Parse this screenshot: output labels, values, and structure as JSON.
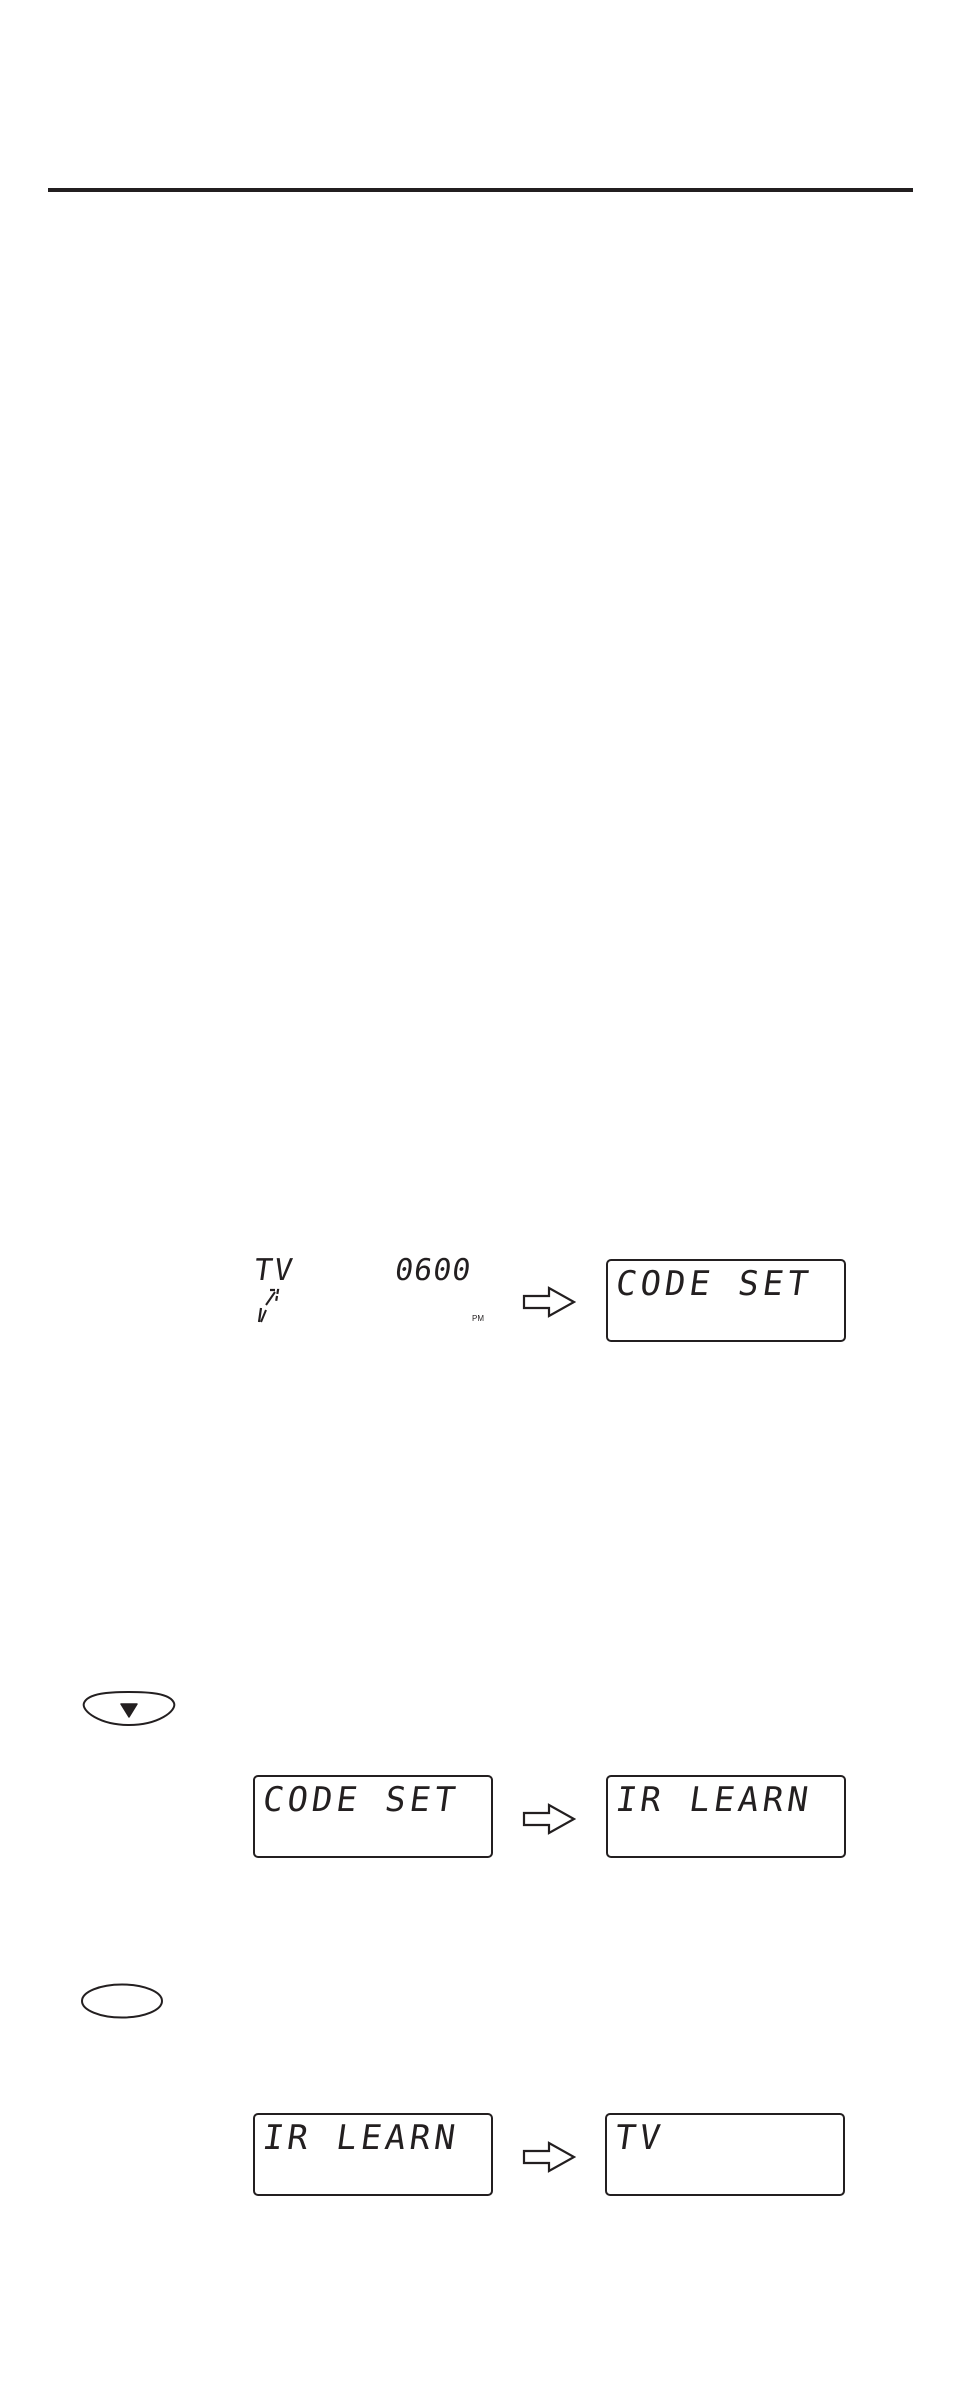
{
  "page": {
    "rule": true
  },
  "step1": {
    "from_display": {
      "mode": "TV",
      "clock": "06:00",
      "clock_digits": "0600",
      "period": "PM",
      "indicator": "signal-arrows"
    },
    "to_display": {
      "text": "CODE SET"
    }
  },
  "step2": {
    "button": {
      "icon": "down-arrow-icon",
      "glyph": "▼"
    },
    "from_display": {
      "text": "CODE SET"
    },
    "to_display": {
      "text": "IR LEARN"
    }
  },
  "step3": {
    "button": {
      "icon": "oval-button-icon"
    },
    "from_display": {
      "text": "IR LEARN"
    },
    "to_display": {
      "text": "TV"
    }
  },
  "colors": {
    "ink": "#231f20",
    "paper": "#ffffff"
  }
}
